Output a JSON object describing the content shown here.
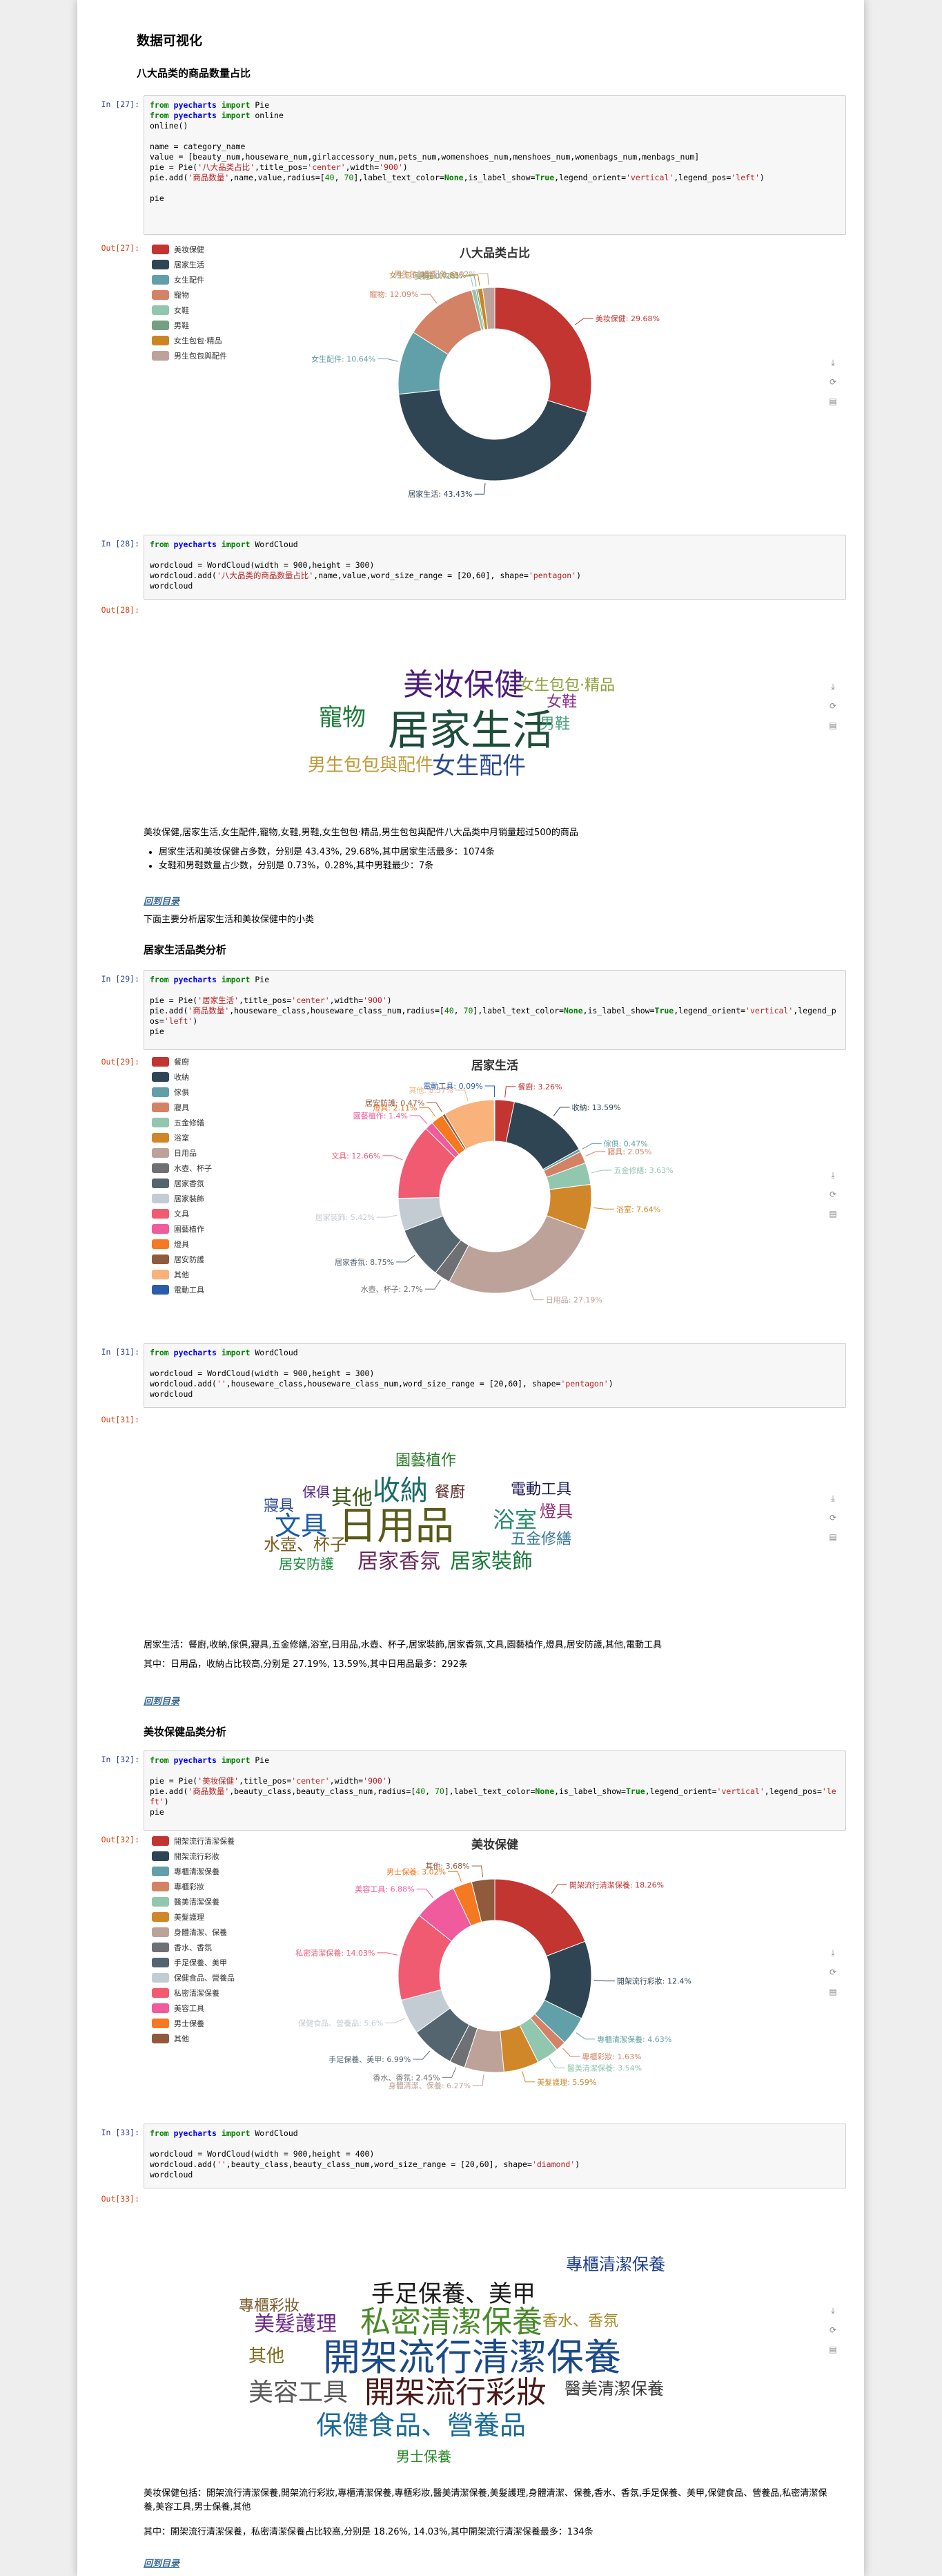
{
  "sections": {
    "title": "数据可视化",
    "sub1": "八大品类的商品数量占比",
    "sub2": "居家生活品类分析",
    "sub3": "美妆保健品类分析"
  },
  "cells": {
    "c27": {
      "in": "In [27]:",
      "out": "Out[27]:"
    },
    "c28": {
      "in": "In [28]:",
      "out": "Out[28]:"
    },
    "c29": {
      "in": "In [29]:",
      "out": "Out[29]:"
    },
    "c31": {
      "in": "In [31]:",
      "out": "Out[31]:"
    },
    "c32": {
      "in": "In [32]:",
      "out": "Out[32]:"
    },
    "c33": {
      "in": "In [33]:",
      "out": "Out[33]:"
    }
  },
  "code": {
    "c27": [
      "from pyecharts import Pie",
      "from pyecharts import online",
      "online()",
      "",
      "name = category_name",
      "value = [beauty_num,houseware_num,girlaccessory_num,pets_num,womenshoes_num,menshoes_num,womenbags_num,menbags_num]",
      "pie = Pie('八大品类占比',title_pos='center',width='900')",
      "pie.add('商品数量',name,value,radius=[40, 70],label_text_color=None,is_label_show=True,legend_orient='vertical',legend_pos='left')",
      "",
      "pie"
    ],
    "c28": [
      "from pyecharts import WordCloud",
      "",
      "wordcloud = WordCloud(width = 900,height = 300)",
      "wordcloud.add('八大品类的商品数量占比',name,value,word_size_range = [20,60], shape='pentagon')",
      "wordcloud"
    ],
    "c29": [
      "from pyecharts import Pie",
      "",
      "pie = Pie('居家生活',title_pos='center',width='900')",
      "pie.add('商品数量',houseware_class,houseware_class_num,radius=[40, 70],label_text_color=None,is_label_show=True,legend_orient='vertical',legend_pos='left')",
      "pie"
    ],
    "c31": [
      "from pyecharts import WordCloud",
      "",
      "wordcloud = WordCloud(width = 900,height = 300)",
      "wordcloud.add('',houseware_class,houseware_class_num,word_size_range = [20,60], shape='pentagon')",
      "wordcloud"
    ],
    "c32": [
      "from pyecharts import Pie",
      "",
      "pie = Pie('美妆保健',title_pos='center',width='900')",
      "pie.add('商品数量',beauty_class,beauty_class_num,radius=[40, 70],label_text_color=None,is_label_show=True,legend_orient='vertical',legend_pos='left')",
      "pie"
    ],
    "c33": [
      "from pyecharts import WordCloud",
      "",
      "wordcloud = WordCloud(width = 900,height = 400)",
      "wordcloud.add('',beauty_class,beauty_class_num,word_size_range = [20,60], shape='diamond')",
      "wordcloud"
    ]
  },
  "chart_data": [
    {
      "type": "pie",
      "title": "八大品类占比",
      "legend_position": "left",
      "categories": [
        "美妆保健",
        "居家生活",
        "女生配件",
        "寵物",
        "女鞋",
        "男鞋",
        "女生包包·精品",
        "男生包包與配件"
      ],
      "values": [
        29.68,
        43.43,
        10.64,
        12.09,
        0.73,
        0.28,
        0.83,
        2.02
      ],
      "colors": [
        "#c23531",
        "#2f4554",
        "#61a0a8",
        "#d48265",
        "#91c7ae",
        "#749f83",
        "#ca8622",
        "#bda29a"
      ],
      "labels": [
        "美妆保健: 29.68%",
        "居家生活: 43.43%",
        "女生配件: 10.64%",
        "寵物: 12.09%",
        "女鞋: 0.73%",
        "男鞋: 0.28%",
        "女生包包·精品: 0.83%",
        "男生包包與配件: 2.02%"
      ]
    },
    {
      "type": "pie",
      "title": "居家生活",
      "legend_position": "left",
      "categories": [
        "餐廚",
        "收納",
        "傢俱",
        "寢具",
        "五金修繕",
        "浴室",
        "日用品",
        "水壺、杯子",
        "居家香氛",
        "居家裝飾",
        "文具",
        "園藝植作",
        "燈具",
        "居安防護",
        "其他",
        "電動工具"
      ],
      "values": [
        3.26,
        13.59,
        0.47,
        2.05,
        3.63,
        7.64,
        27.19,
        2.7,
        8.75,
        5.42,
        12.66,
        1.4,
        2.11,
        0.47,
        8.57,
        0.09
      ],
      "colors": [
        "#c23531",
        "#2f4554",
        "#61a0a8",
        "#d48265",
        "#91c7ae",
        "#d0872a",
        "#bda29a",
        "#6e7074",
        "#546570",
        "#c4ccd3",
        "#f05b72",
        "#ef5b9c",
        "#f47920",
        "#905a3d",
        "#fab27b",
        "#2a5caa"
      ],
      "labels": [
        "餐廚: 3.26%",
        "收納: 13.59%",
        "傢俱: 0.47%",
        "寢具: 2.05%",
        "五金修繕: 3.63%",
        "浴室: 7.64%",
        "日用品: 27.19%",
        "水壺、杯子: 2.7%",
        "居家香氛: 8.75%",
        "居家裝飾: 5.42%",
        "文具: 12.66%",
        "園藝植作: 1.4%",
        "燈具: 2.11%",
        "居安防護: 0.47%",
        "其他: 8.57%",
        "電動工具: 0.09%"
      ]
    },
    {
      "type": "pie",
      "title": "美妆保健",
      "legend_position": "left",
      "categories": [
        "開架流行清潔保養",
        "開架流行彩妝",
        "專櫃清潔保養",
        "專櫃彩妝",
        "醫美清潔保養",
        "美髮護理",
        "身體清潔、保養",
        "香水、香氛",
        "手足保養、美甲",
        "保健食品、營養品",
        "私密清潔保養",
        "美容工具",
        "男士保養",
        "其他"
      ],
      "values": [
        18.26,
        12.4,
        4.63,
        1.63,
        3.54,
        5.59,
        6.27,
        2.45,
        6.99,
        5.6,
        14.03,
        6.88,
        3.02,
        3.68
      ],
      "colors": [
        "#c23531",
        "#2f4554",
        "#61a0a8",
        "#d48265",
        "#91c7ae",
        "#d0872a",
        "#bda29a",
        "#6e7074",
        "#546570",
        "#c4ccd3",
        "#f05b72",
        "#ef5b9c",
        "#f47920",
        "#905a3d"
      ],
      "labels": [
        "開架流行清潔保養: 18.26%",
        "開架流行彩妝: 12.4%",
        "專櫃清潔保養: 4.63%",
        "專櫃彩妝: 1.63%",
        "醫美清潔保養: 3.54%",
        "美髮護理: 5.59%",
        "身體清潔、保養: 6.27%",
        "香水、香氛: 2.45%",
        "手足保養、美甲: 6.99%",
        "保健食品、營養品: 5.6%",
        "私密清潔保養: 14.03%",
        "美容工具: 6.88%",
        "男士保養: 3.02%",
        "其他: 3.68%"
      ]
    }
  ],
  "wordclouds": {
    "wc1": [
      {
        "t": "美妆保健",
        "c": "#4b1b7a",
        "s": 44
      },
      {
        "t": "居家生活",
        "c": "#1e4d3b",
        "s": 60
      },
      {
        "t": "寵物",
        "c": "#1f7a3a",
        "s": 34
      },
      {
        "t": "女生包包·精品",
        "c": "#8aa23a",
        "s": 22
      },
      {
        "t": "女鞋",
        "c": "#8a2a8a",
        "s": 22
      },
      {
        "t": "男鞋",
        "c": "#4aa07a",
        "s": 22
      },
      {
        "t": "男生包包與配件",
        "c": "#c09a3a",
        "s": 26
      },
      {
        "t": "女生配件",
        "c": "#2a4a8a",
        "s": 34
      }
    ],
    "wc2": [
      {
        "t": "園藝植作",
        "c": "#2a7a2a",
        "s": 22
      },
      {
        "t": "保俱",
        "c": "#5a2a8a",
        "s": 20
      },
      {
        "t": "其他",
        "c": "#3a5a1a",
        "s": 30
      },
      {
        "t": "收納",
        "c": "#1a6a6a",
        "s": 40
      },
      {
        "t": "餐廚",
        "c": "#5a2a2a",
        "s": 22
      },
      {
        "t": "電動工具",
        "c": "#1a1a5a",
        "s": 22
      },
      {
        "t": "寢具",
        "c": "#2a4a8a",
        "s": 22
      },
      {
        "t": "文具",
        "c": "#1a5aaa",
        "s": 38
      },
      {
        "t": "日用品",
        "c": "#5a5a1a",
        "s": 56
      },
      {
        "t": "浴室",
        "c": "#2a8a6a",
        "s": 32
      },
      {
        "t": "燈具",
        "c": "#8a2a6a",
        "s": 24
      },
      {
        "t": "水壺、杯子",
        "c": "#7a5a1a",
        "s": 24
      },
      {
        "t": "五金修繕",
        "c": "#3a7a9a",
        "s": 22
      },
      {
        "t": "居安防護",
        "c": "#1a8a3a",
        "s": 20
      },
      {
        "t": "居家香氛",
        "c": "#6a2a5a",
        "s": 30
      },
      {
        "t": "居家裝飾",
        "c": "#1a7a3a",
        "s": 30
      }
    ],
    "wc3": [
      {
        "t": "專櫃清潔保養",
        "c": "#1a3a8a",
        "s": 24
      },
      {
        "t": "手足保養、美甲",
        "c": "#1a1a1a",
        "s": 34
      },
      {
        "t": "專櫃彩妝",
        "c": "#7a5a2a",
        "s": 22
      },
      {
        "t": "美髮護理",
        "c": "#6a2a8a",
        "s": 30
      },
      {
        "t": "私密清潔保養",
        "c": "#4a8a2a",
        "s": 44
      },
      {
        "t": "香水、香氛",
        "c": "#aa8a2a",
        "s": 22
      },
      {
        "t": "其他",
        "c": "#7a6a1a",
        "s": 26
      },
      {
        "t": "開架流行清潔保養",
        "c": "#1a4a8a",
        "s": 54
      },
      {
        "t": "美容工具",
        "c": "#5a5a5a",
        "s": 36
      },
      {
        "t": "開架流行彩妝",
        "c": "#4a1a1a",
        "s": 44
      },
      {
        "t": "醫美清潔保養",
        "c": "#3a3a3a",
        "s": 24
      },
      {
        "t": "保健食品、營養品",
        "c": "#1a6a9a",
        "s": 38
      },
      {
        "t": "男士保養",
        "c": "#2a8a2a",
        "s": 20
      }
    ]
  },
  "toolbox": {
    "save": "save-icon",
    "refresh": "refresh-icon",
    "dataview": "data-view-icon"
  },
  "text": {
    "p1": "美妆保健,居家生活,女生配件,寵物,女鞋,男鞋,女生包包·精品,男生包包與配件八大品类中月销量超过500的商品",
    "b1": "居家生活和美妆保健占多数，分别是 43.43%, 29.68%,其中居家生活最多：1074条",
    "b2": "女鞋和男鞋数量占少数，分别是 0.73%，0.28%,其中男鞋最少：7条",
    "link": "回到目录",
    "p2": "下面主要分析居家生活和美妆保健中的小类",
    "p3": "居家生活：餐廚,收納,傢俱,寢具,五金修繕,浴室,日用品,水壺、杯子,居家裝飾,居家香氛,文具,園藝植作,燈具,居安防護,其他,電動工具",
    "p4": "其中：日用品，收納占比较高,分别是 27.19%, 13.59%,其中日用品最多：292条",
    "p5": "美妆保健包括：開架流行清潔保養,開架流行彩妝,專櫃清潔保養,專櫃彩妝,醫美清潔保養,美髮護理,身體清潔、保養,香水、香氛,手足保養、美甲,保健食品、營養品,私密清潔保養,美容工具,男士保養,其他",
    "p6": "其中：開架流行清潔保養，私密清潔保養占比较高,分别是 18.26%, 14.03%,其中開架流行清潔保養最多：134条"
  }
}
